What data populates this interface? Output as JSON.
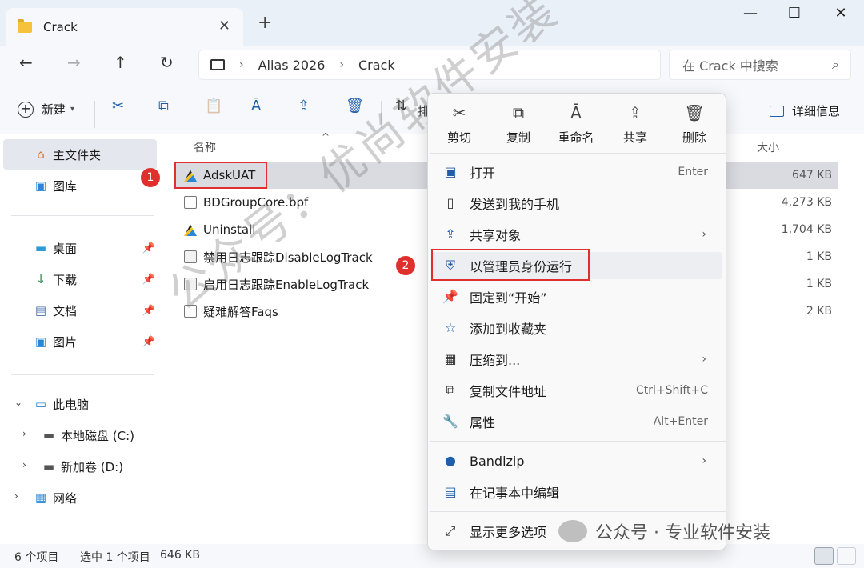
{
  "window": {
    "tab_title": "Crack",
    "new_tab": "+",
    "close_tab": "✕",
    "controls": [
      "—",
      "☐",
      "✕"
    ]
  },
  "nav": {
    "back": "←",
    "forward": "→",
    "up": "↑",
    "refresh": "↻",
    "breadcrumb": [
      "Alias 2026",
      "Crack"
    ],
    "breadcrumb_sep": "›",
    "search_placeholder": "在 Crack 中搜索",
    "search_icon": "⌕"
  },
  "toolbar": {
    "new_label": "新建",
    "new_arrow": "▾",
    "sort_icon": "⇅",
    "sort_label": "排",
    "details_label": "详细信息",
    "icons": {
      "cut": "✂",
      "copy": "⧉",
      "paste": "📋",
      "rename": "Ā",
      "share": "⇪",
      "delete": "🗑"
    }
  },
  "sidebar": {
    "home": "主文件夹",
    "gallery": "图库",
    "quick": [
      {
        "label": "桌面",
        "icon": "▬"
      },
      {
        "label": "下载",
        "icon": "↓"
      },
      {
        "label": "文档",
        "icon": "▤"
      },
      {
        "label": "图片",
        "icon": "▣"
      }
    ],
    "pin_icon": "📌",
    "this_pc": "此电脑",
    "drives": [
      "本地磁盘 (C:)",
      "新加卷 (D:)"
    ],
    "network": "网络",
    "expand_icon": "›",
    "collapse_icon": "⌄"
  },
  "filelist": {
    "col_name": "名称",
    "col_size": "大小",
    "sort_caret": "^",
    "files": [
      {
        "name": "AdskUAT",
        "size": "647 KB",
        "type": "exe"
      },
      {
        "name": "BDGroupCore.bpf",
        "size": "4,273 KB",
        "type": "doc"
      },
      {
        "name": "Uninstall",
        "size": "1,704 KB",
        "type": "exe"
      },
      {
        "name": "禁用日志跟踪DisableLogTrack",
        "size": "1 KB",
        "type": "bat"
      },
      {
        "name": "启用日志跟踪EnableLogTrack",
        "size": "1 KB",
        "type": "bat"
      },
      {
        "name": "疑难解答Faqs",
        "size": "2 KB",
        "type": "doc"
      }
    ],
    "badge1": "1",
    "badge2": "2"
  },
  "status": {
    "count": "6 个项目",
    "selected": "选中 1 个项目",
    "sel_size": "646 KB"
  },
  "context_menu": {
    "tools": [
      {
        "label": "剪切",
        "icon": "✂"
      },
      {
        "label": "复制",
        "icon": "⧉"
      },
      {
        "label": "重命名",
        "icon": "Ā"
      },
      {
        "label": "共享",
        "icon": "⇪"
      },
      {
        "label": "删除",
        "icon": "🗑"
      }
    ],
    "items": [
      {
        "label": "打开",
        "accel": "Enter",
        "icon": "▣"
      },
      {
        "label": "发送到我的手机",
        "accel": "",
        "icon": "▯"
      },
      {
        "label": "共享对象",
        "accel": "",
        "icon": "⇪",
        "sub": "›"
      },
      {
        "label": "以管理员身份运行",
        "accel": "",
        "icon": "⛨"
      },
      {
        "label": "固定到“开始”",
        "accel": "",
        "icon": "📌"
      },
      {
        "label": "添加到收藏夹",
        "accel": "",
        "icon": "☆"
      },
      {
        "label": "压缩到...",
        "accel": "",
        "icon": "▦",
        "sub": "›"
      },
      {
        "label": "复制文件地址",
        "accel": "Ctrl+Shift+C",
        "icon": "⧉"
      },
      {
        "label": "属性",
        "accel": "Alt+Enter",
        "icon": "🔧"
      },
      {
        "label": "Bandizip",
        "accel": "",
        "icon": "●",
        "sub": "›"
      },
      {
        "label": "在记事本中编辑",
        "accel": "",
        "icon": "▤"
      },
      {
        "label": "显示更多选项",
        "accel": "",
        "icon": "⤢"
      }
    ]
  },
  "watermark": {
    "diagonal": "公众号：优尚软件安装",
    "bottom": "公众号 · 专业软件安装"
  }
}
